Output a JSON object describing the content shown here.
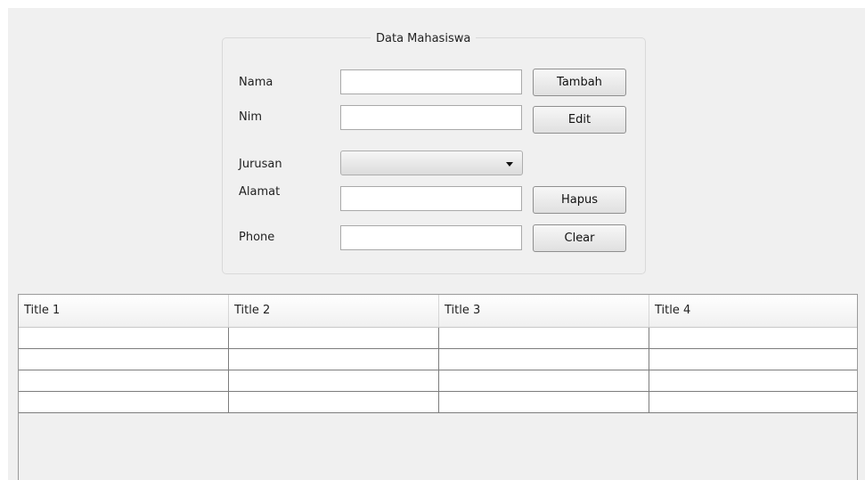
{
  "form": {
    "title": "Data Mahasiswa",
    "labels": {
      "nama": "Nama",
      "nim": "Nim",
      "jurusan": "Jurusan",
      "alamat": "Alamat",
      "phone": "Phone"
    },
    "values": {
      "nama": "",
      "nim": "",
      "jurusan": "",
      "alamat": "",
      "phone": ""
    },
    "buttons": {
      "tambah": "Tambah",
      "edit": "Edit",
      "hapus": "Hapus",
      "clear": "Clear"
    }
  },
  "table": {
    "columns": [
      "Title 1",
      "Title 2",
      "Title 3",
      "Title 4"
    ],
    "rows": [
      [
        "",
        "",
        "",
        ""
      ],
      [
        "",
        "",
        "",
        ""
      ],
      [
        "",
        "",
        "",
        ""
      ],
      [
        "",
        "",
        "",
        ""
      ]
    ]
  },
  "icons": {
    "combo_arrow": "dropdown-arrow-icon"
  }
}
